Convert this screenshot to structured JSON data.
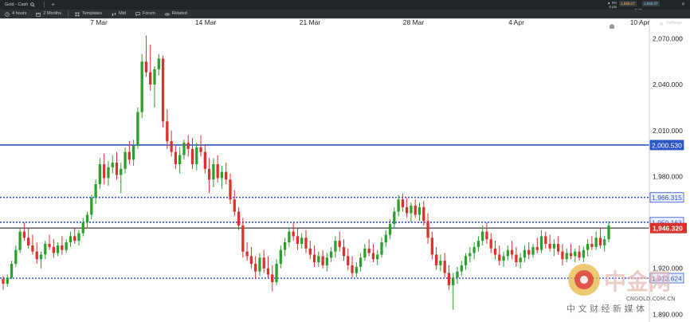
{
  "header": {
    "instrument": "Gold - Cash",
    "sell_price": "1,946.07",
    "buy_price": "1,946.37",
    "change": "▲ 0%",
    "change_pts": "0 pts",
    "spread": "0.30"
  },
  "toolbar": {
    "timeframe": "4 hours",
    "range": "2 Months",
    "templates": "Templates",
    "price_type": "Mid",
    "forum": "Forum",
    "related": "Related",
    "settings": "Settings"
  },
  "colors": {
    "up": "#2aa02a",
    "down": "#d9312b",
    "strong_line": "#2c58c5",
    "dotted_line": "#2f55c9",
    "current_line": "#111111",
    "current_tag": "#d9312b"
  },
  "watermark": {
    "brand": "中金网",
    "url": "CNGOLD.COM.CN",
    "tagline": "中 文 财 经 新 媒 体"
  },
  "chart_data": {
    "type": "candlestick",
    "instrument": "Gold - Cash",
    "timeframe": "4 hours",
    "x_tick_labels": [
      "7 Mar",
      "14 Mar",
      "21 Mar",
      "28 Mar",
      "4 Apr",
      "10 Apr"
    ],
    "y_tick_labels": [
      "2,070.000",
      "2,040.000",
      "2,010.000",
      "1,980.000",
      "1,950.000",
      "1,920.000",
      "1,890.000"
    ],
    "y_ticks": [
      2070,
      2040,
      2010,
      1980,
      1950,
      1920,
      1890
    ],
    "ylim": [
      1885,
      2077
    ],
    "grid": false,
    "horizontal_levels": [
      {
        "value": 2000.53,
        "label": "2,000.530",
        "style": "solid"
      },
      {
        "value": 1966.315,
        "label": "1,966.315",
        "style": "dotted"
      },
      {
        "value": 1950.163,
        "label": "1,950.163",
        "style": "dotted"
      },
      {
        "value": 1913.624,
        "label": "1,913.624",
        "style": "dotted"
      }
    ],
    "current_price": {
      "value": 1946.32,
      "label": "1,946.320"
    },
    "ohlc": [
      [
        1913,
        1915,
        1906,
        1910
      ],
      [
        1910,
        1916,
        1908,
        1914
      ],
      [
        1914,
        1925,
        1913,
        1923
      ],
      [
        1923,
        1935,
        1921,
        1932
      ],
      [
        1932,
        1946,
        1930,
        1944
      ],
      [
        1944,
        1950,
        1938,
        1940
      ],
      [
        1940,
        1946,
        1933,
        1935
      ],
      [
        1935,
        1942,
        1929,
        1931
      ],
      [
        1931,
        1937,
        1923,
        1926
      ],
      [
        1926,
        1931,
        1920,
        1929
      ],
      [
        1929,
        1938,
        1926,
        1936
      ],
      [
        1936,
        1942,
        1932,
        1934
      ],
      [
        1934,
        1939,
        1927,
        1930
      ],
      [
        1930,
        1937,
        1928,
        1935
      ],
      [
        1935,
        1941,
        1929,
        1932
      ],
      [
        1932,
        1939,
        1930,
        1937
      ],
      [
        1937,
        1944,
        1934,
        1941
      ],
      [
        1941,
        1946,
        1936,
        1938
      ],
      [
        1938,
        1945,
        1935,
        1943
      ],
      [
        1943,
        1953,
        1941,
        1950
      ],
      [
        1950,
        1957,
        1946,
        1955
      ],
      [
        1955,
        1968,
        1952,
        1966
      ],
      [
        1966,
        1978,
        1962,
        1975
      ],
      [
        1975,
        1992,
        1972,
        1988
      ],
      [
        1988,
        1995,
        1975,
        1979
      ],
      [
        1979,
        1990,
        1974,
        1986
      ],
      [
        1986,
        1994,
        1982,
        1989
      ],
      [
        1989,
        1996,
        1978,
        1981
      ],
      [
        1981,
        1989,
        1969,
        1985
      ],
      [
        1985,
        1999,
        1982,
        1996
      ],
      [
        1996,
        2003,
        1988,
        1991
      ],
      [
        1991,
        2004,
        1987,
        2000
      ],
      [
        2000,
        2025,
        1998,
        2022
      ],
      [
        2022,
        2060,
        2018,
        2055
      ],
      [
        2055,
        2072,
        2045,
        2048
      ],
      [
        2048,
        2066,
        2036,
        2040
      ],
      [
        2040,
        2052,
        2025,
        2050
      ],
      [
        2050,
        2060,
        2046,
        2057
      ],
      [
        2057,
        2059,
        2012,
        2016
      ],
      [
        2016,
        2024,
        1998,
        2003
      ],
      [
        2003,
        2010,
        1993,
        1996
      ],
      [
        1996,
        2000,
        1985,
        1988
      ],
      [
        1988,
        1999,
        1982,
        1994
      ],
      [
        1994,
        2004,
        1991,
        2002
      ],
      [
        2002,
        2007,
        1993,
        1998
      ],
      [
        1998,
        2005,
        1985,
        1988
      ],
      [
        1988,
        2002,
        1984,
        1999
      ],
      [
        1999,
        2007,
        1993,
        1996
      ],
      [
        1996,
        2001,
        1982,
        1985
      ],
      [
        1985,
        1992,
        1969,
        1978
      ],
      [
        1978,
        1992,
        1973,
        1988
      ],
      [
        1988,
        1994,
        1976,
        1979
      ],
      [
        1979,
        1987,
        1972,
        1983
      ],
      [
        1983,
        1989,
        1975,
        1978
      ],
      [
        1978,
        1982,
        1962,
        1965
      ],
      [
        1965,
        1971,
        1954,
        1957
      ],
      [
        1957,
        1960,
        1945,
        1948
      ],
      [
        1948,
        1953,
        1927,
        1931
      ],
      [
        1931,
        1937,
        1925,
        1928
      ],
      [
        1928,
        1934,
        1920,
        1923
      ],
      [
        1923,
        1928,
        1913,
        1918
      ],
      [
        1918,
        1930,
        1915,
        1927
      ],
      [
        1927,
        1932,
        1917,
        1920
      ],
      [
        1920,
        1928,
        1914,
        1916
      ],
      [
        1916,
        1922,
        1905,
        1911
      ],
      [
        1911,
        1926,
        1909,
        1923
      ],
      [
        1923,
        1935,
        1920,
        1932
      ],
      [
        1932,
        1940,
        1928,
        1937
      ],
      [
        1937,
        1947,
        1934,
        1944
      ],
      [
        1944,
        1950,
        1938,
        1941
      ],
      [
        1941,
        1946,
        1932,
        1936
      ],
      [
        1936,
        1943,
        1933,
        1940
      ],
      [
        1940,
        1945,
        1930,
        1933
      ],
      [
        1933,
        1938,
        1926,
        1929
      ],
      [
        1929,
        1935,
        1921,
        1924
      ],
      [
        1924,
        1931,
        1921,
        1928
      ],
      [
        1928,
        1932,
        1920,
        1922
      ],
      [
        1922,
        1930,
        1918,
        1927
      ],
      [
        1927,
        1934,
        1924,
        1931
      ],
      [
        1931,
        1941,
        1927,
        1938
      ],
      [
        1938,
        1944,
        1931,
        1934
      ],
      [
        1934,
        1939,
        1925,
        1928
      ],
      [
        1928,
        1933,
        1919,
        1922
      ],
      [
        1922,
        1928,
        1914,
        1917
      ],
      [
        1917,
        1924,
        1914,
        1921
      ],
      [
        1921,
        1930,
        1918,
        1927
      ],
      [
        1927,
        1936,
        1925,
        1933
      ],
      [
        1933,
        1939,
        1928,
        1930
      ],
      [
        1930,
        1936,
        1924,
        1926
      ],
      [
        1926,
        1932,
        1922,
        1929
      ],
      [
        1929,
        1940,
        1927,
        1937
      ],
      [
        1937,
        1945,
        1934,
        1942
      ],
      [
        1942,
        1952,
        1939,
        1949
      ],
      [
        1949,
        1960,
        1946,
        1957
      ],
      [
        1957,
        1968,
        1954,
        1965
      ],
      [
        1965,
        1969,
        1957,
        1960
      ],
      [
        1960,
        1966,
        1953,
        1956
      ],
      [
        1956,
        1963,
        1950,
        1961
      ],
      [
        1961,
        1965,
        1953,
        1955
      ],
      [
        1955,
        1963,
        1951,
        1960
      ],
      [
        1960,
        1964,
        1948,
        1951
      ],
      [
        1951,
        1956,
        1936,
        1940
      ],
      [
        1940,
        1944,
        1926,
        1929
      ],
      [
        1929,
        1934,
        1919,
        1922
      ],
      [
        1922,
        1929,
        1918,
        1925
      ],
      [
        1925,
        1930,
        1914,
        1917
      ],
      [
        1917,
        1922,
        1906,
        1909
      ],
      [
        1909,
        1917,
        1893,
        1914
      ],
      [
        1914,
        1921,
        1910,
        1918
      ],
      [
        1918,
        1925,
        1915,
        1922
      ],
      [
        1922,
        1930,
        1919,
        1928
      ],
      [
        1928,
        1934,
        1924,
        1930
      ],
      [
        1930,
        1937,
        1926,
        1934
      ],
      [
        1934,
        1941,
        1931,
        1938
      ],
      [
        1938,
        1948,
        1935,
        1944
      ],
      [
        1944,
        1950,
        1936,
        1939
      ],
      [
        1939,
        1943,
        1930,
        1933
      ],
      [
        1933,
        1938,
        1926,
        1929
      ],
      [
        1929,
        1935,
        1922,
        1925
      ],
      [
        1925,
        1931,
        1921,
        1928
      ],
      [
        1928,
        1935,
        1925,
        1932
      ],
      [
        1932,
        1938,
        1926,
        1929
      ],
      [
        1929,
        1934,
        1921,
        1924
      ],
      [
        1924,
        1930,
        1920,
        1927
      ],
      [
        1927,
        1935,
        1924,
        1932
      ],
      [
        1932,
        1937,
        1926,
        1929
      ],
      [
        1929,
        1936,
        1927,
        1934
      ],
      [
        1934,
        1940,
        1930,
        1932
      ],
      [
        1932,
        1945,
        1930,
        1941
      ],
      [
        1941,
        1944,
        1933,
        1936
      ],
      [
        1936,
        1942,
        1931,
        1933
      ],
      [
        1933,
        1939,
        1928,
        1936
      ],
      [
        1936,
        1941,
        1929,
        1931
      ],
      [
        1931,
        1936,
        1922,
        1926
      ],
      [
        1926,
        1933,
        1924,
        1930
      ],
      [
        1930,
        1936,
        1926,
        1928
      ],
      [
        1928,
        1933,
        1924,
        1931
      ],
      [
        1931,
        1935,
        1925,
        1927
      ],
      [
        1927,
        1934,
        1924,
        1932
      ],
      [
        1932,
        1939,
        1928,
        1936
      ],
      [
        1936,
        1941,
        1932,
        1934
      ],
      [
        1934,
        1944,
        1932,
        1940
      ],
      [
        1940,
        1946,
        1933,
        1935
      ],
      [
        1935,
        1941,
        1931,
        1939
      ],
      [
        1939,
        1951,
        1937,
        1948
      ]
    ]
  }
}
